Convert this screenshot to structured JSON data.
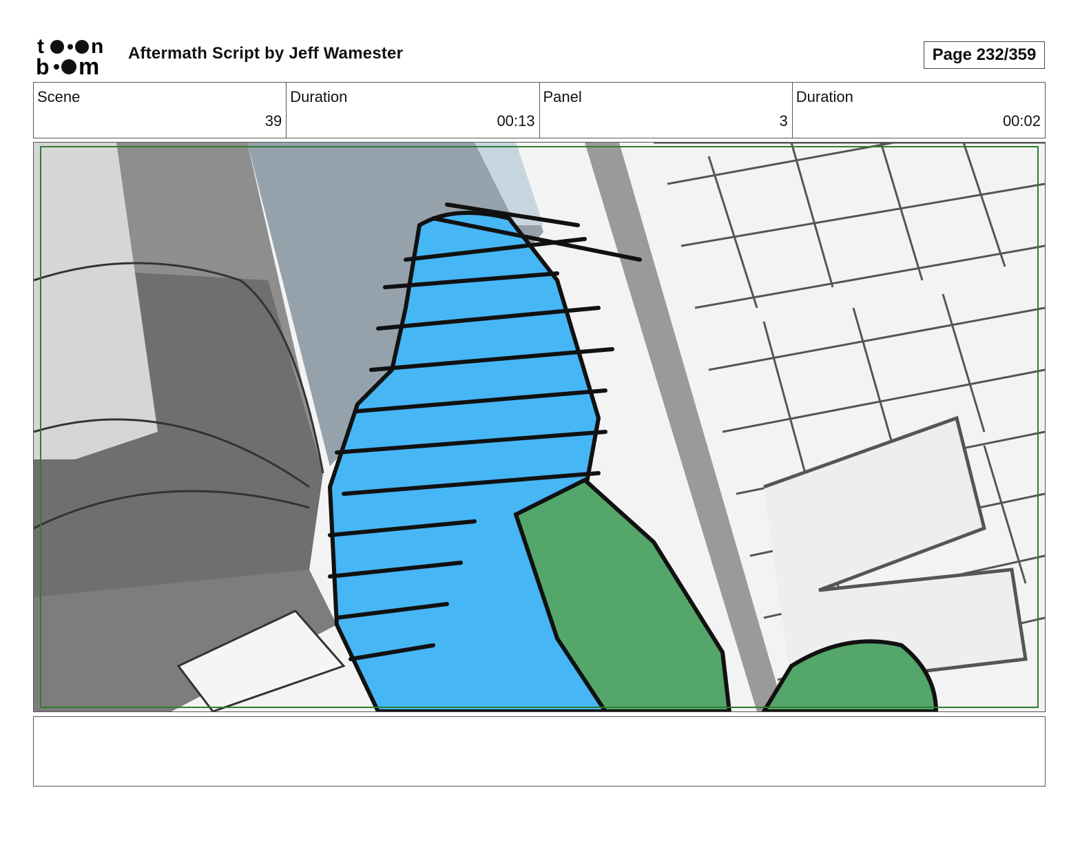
{
  "header": {
    "logo_text_top": "toon",
    "logo_text_bottom": "boom",
    "title": "Aftermath  Script by Jeff Wamester",
    "page_label": "Page 232/359"
  },
  "info": {
    "scene_label": "Scene",
    "scene_value": "39",
    "scene_duration_label": "Duration",
    "scene_duration_value": "00:13",
    "panel_label": "Panel",
    "panel_value": "3",
    "panel_duration_label": "Duration",
    "panel_duration_value": "00:02"
  },
  "panel_image": {
    "description_icon": "storyboard-drawing",
    "colors": {
      "hero_blue": "#47b6f5",
      "villain_green": "#55a66a",
      "safe_frame": "#2e7d32",
      "sky": "#95a2ab"
    }
  },
  "notes": {
    "text": ""
  }
}
